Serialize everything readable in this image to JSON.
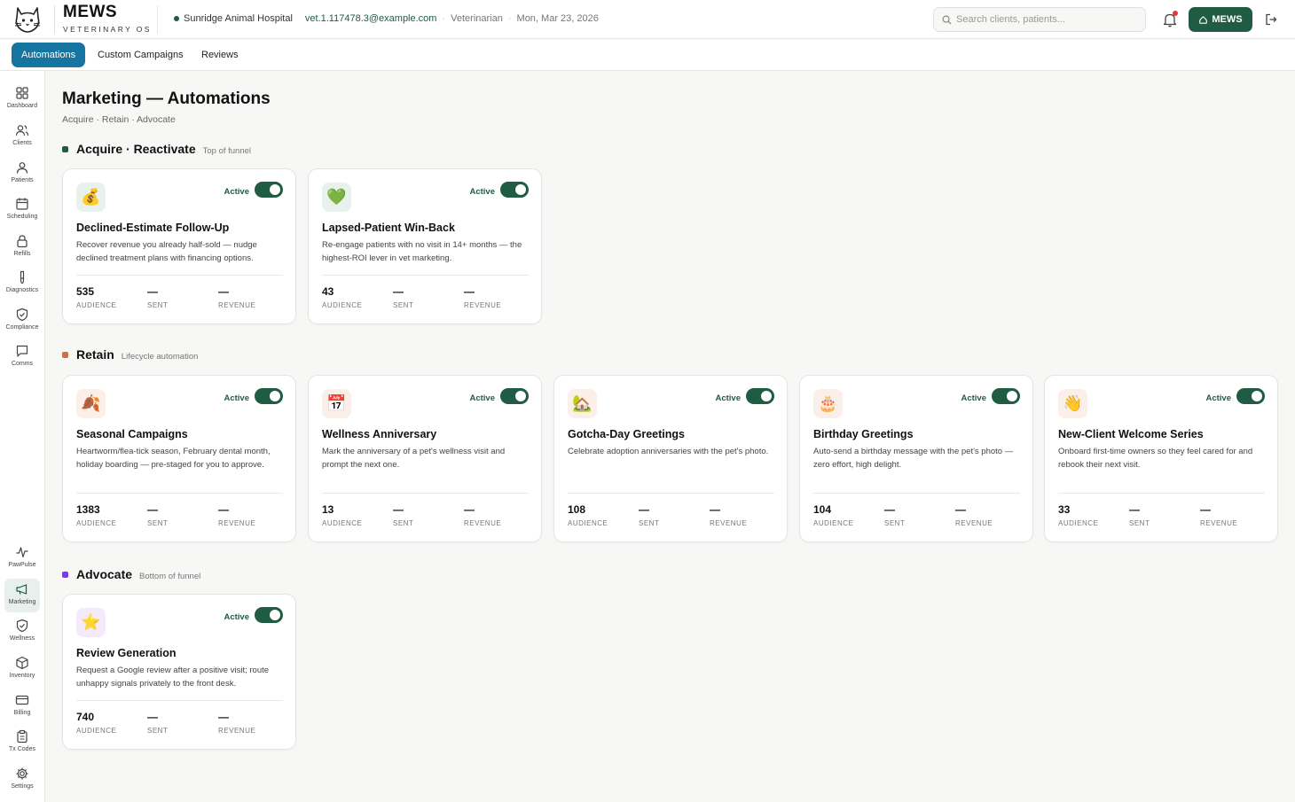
{
  "header": {
    "brand": "MEWS",
    "brand_sub": "VETERINARY OS",
    "clinic": "Sunridge Animal Hospital",
    "email": "vet.1.117478.3@example.com",
    "role": "Veterinarian",
    "date": "Mon, Mar 23, 2026",
    "separator": "·",
    "search_placeholder": "Search clients, patients...",
    "mews_button": "MEWS",
    "notification_dot_color": "#e03b3b",
    "accent_color": "#1f5c43"
  },
  "subnav": {
    "tabs": [
      {
        "label": "Automations",
        "active": true
      },
      {
        "label": "Custom Campaigns",
        "active": false
      },
      {
        "label": "Reviews",
        "active": false
      }
    ]
  },
  "sidebar": {
    "items": [
      {
        "label": "Dashboard",
        "icon": "grid-icon"
      },
      {
        "label": "Clients",
        "icon": "users-icon"
      },
      {
        "label": "Patients",
        "icon": "user-icon"
      },
      {
        "label": "Scheduling",
        "icon": "calendar-icon"
      },
      {
        "label": "Refills",
        "icon": "lock-icon"
      },
      {
        "label": "Diagnostics",
        "icon": "flask-icon"
      },
      {
        "label": "Compliance",
        "icon": "shield-check-icon"
      },
      {
        "label": "Comms",
        "icon": "message-icon"
      },
      {
        "label": "PawPulse",
        "icon": "pulse-icon"
      },
      {
        "label": "Marketing",
        "icon": "megaphone-icon",
        "active": true
      },
      {
        "label": "Wellness",
        "icon": "shield-check-icon"
      },
      {
        "label": "Inventory",
        "icon": "box-icon"
      },
      {
        "label": "Billing",
        "icon": "credit-card-icon"
      },
      {
        "label": "Tx Codes",
        "icon": "clipboard-icon"
      },
      {
        "label": "Settings",
        "icon": "gear-icon"
      }
    ]
  },
  "page": {
    "title": "Marketing — Automations",
    "subtitle": "Acquire · Retain · Advocate"
  },
  "stat_labels": {
    "audience": "AUDIENCE",
    "sent": "SENT",
    "revenue": "REVENUE"
  },
  "sections": [
    {
      "title": "Acquire · Reactivate",
      "subtitle": "Top of funnel",
      "color": "#1f5c43",
      "cards": [
        {
          "icon": "💰",
          "icon_name": "money-bag-icon",
          "icon_bg": "#e9f1ec",
          "status": "Active",
          "enabled": true,
          "title": "Declined-Estimate Follow-Up",
          "description": "Recover revenue you already half-sold — nudge declined treatment plans with financing options.",
          "audience": "535",
          "sent": "—",
          "revenue": "—"
        },
        {
          "icon": "💚",
          "icon_name": "green-heart-icon",
          "icon_bg": "#e9f1ec",
          "status": "Active",
          "enabled": true,
          "title": "Lapsed-Patient Win-Back",
          "description": "Re-engage patients with no visit in 14+ months — the highest-ROI lever in vet marketing.",
          "audience": "43",
          "sent": "—",
          "revenue": "—"
        }
      ]
    },
    {
      "title": "Retain",
      "subtitle": "Lifecycle automation",
      "color": "#c8734a",
      "cards": [
        {
          "icon": "🍂",
          "icon_name": "fallen-leaf-icon",
          "icon_bg": "#fbf0e9",
          "status": "Active",
          "enabled": true,
          "title": "Seasonal Campaigns",
          "description": "Heartworm/flea-tick season, February dental month, holiday boarding — pre-staged for you to approve.",
          "audience": "1383",
          "sent": "—",
          "revenue": "—"
        },
        {
          "icon": "📅",
          "icon_name": "calendar-icon",
          "icon_bg": "#fbf0e9",
          "status": "Active",
          "enabled": true,
          "title": "Wellness Anniversary",
          "description": "Mark the anniversary of a pet's wellness visit and prompt the next one.",
          "audience": "13",
          "sent": "—",
          "revenue": "—"
        },
        {
          "icon": "🏡",
          "icon_name": "house-icon",
          "icon_bg": "#fbf0e9",
          "status": "Active",
          "enabled": true,
          "title": "Gotcha-Day Greetings",
          "description": "Celebrate adoption anniversaries with the pet's photo.",
          "audience": "108",
          "sent": "—",
          "revenue": "—"
        },
        {
          "icon": "🎂",
          "icon_name": "birthday-cake-icon",
          "icon_bg": "#fbf0e9",
          "status": "Active",
          "enabled": true,
          "title": "Birthday Greetings",
          "description": "Auto-send a birthday message with the pet's photo — zero effort, high delight.",
          "audience": "104",
          "sent": "—",
          "revenue": "—"
        },
        {
          "icon": "👋",
          "icon_name": "waving-hand-icon",
          "icon_bg": "#fbf0e9",
          "status": "Active",
          "enabled": true,
          "title": "New-Client Welcome Series",
          "description": "Onboard first-time owners so they feel cared for and rebook their next visit.",
          "audience": "33",
          "sent": "—",
          "revenue": "—"
        }
      ]
    },
    {
      "title": "Advocate",
      "subtitle": "Bottom of funnel",
      "color": "#7c3aed",
      "cards": [
        {
          "icon": "⭐",
          "icon_name": "star-icon",
          "icon_bg": "#f3eafc",
          "status": "Active",
          "enabled": true,
          "title": "Review Generation",
          "description": "Request a Google review after a positive visit; route unhappy signals privately to the front desk.",
          "audience": "740",
          "sent": "—",
          "revenue": "—"
        }
      ]
    }
  ]
}
